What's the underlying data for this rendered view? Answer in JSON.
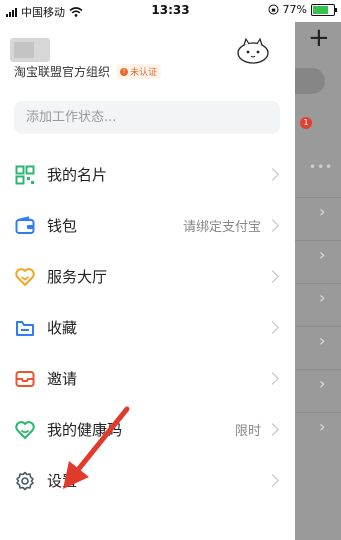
{
  "status_bar": {
    "carrier": "中国移动",
    "time": "13:33",
    "battery_percent": "77%",
    "battery_level": 0.77
  },
  "profile": {
    "org_name": "淘宝联盟官方组织",
    "verify_badge": "未认证"
  },
  "status_input": {
    "placeholder": "添加工作状态..."
  },
  "menu": [
    {
      "label": "我的名片",
      "hint": "",
      "icon": "qr-card-icon"
    },
    {
      "label": "钱包",
      "hint": "请绑定支付宝",
      "icon": "wallet-icon"
    },
    {
      "label": "服务大厅",
      "hint": "",
      "icon": "service-hall-icon"
    },
    {
      "label": "收藏",
      "hint": "",
      "icon": "favorites-icon"
    },
    {
      "label": "邀请",
      "hint": "",
      "icon": "invite-icon"
    },
    {
      "label": "我的健康码",
      "hint": "限时",
      "icon": "health-code-icon"
    },
    {
      "label": "设置",
      "hint": "",
      "icon": "settings-icon"
    }
  ],
  "background_panel": {
    "plus_label": "+",
    "notification_count": "1"
  },
  "colors": {
    "green": "#2bb673",
    "blue": "#2f7df6",
    "yellow": "#f2a825",
    "orange": "#e8562a",
    "red_arrow": "#e23a2a"
  }
}
